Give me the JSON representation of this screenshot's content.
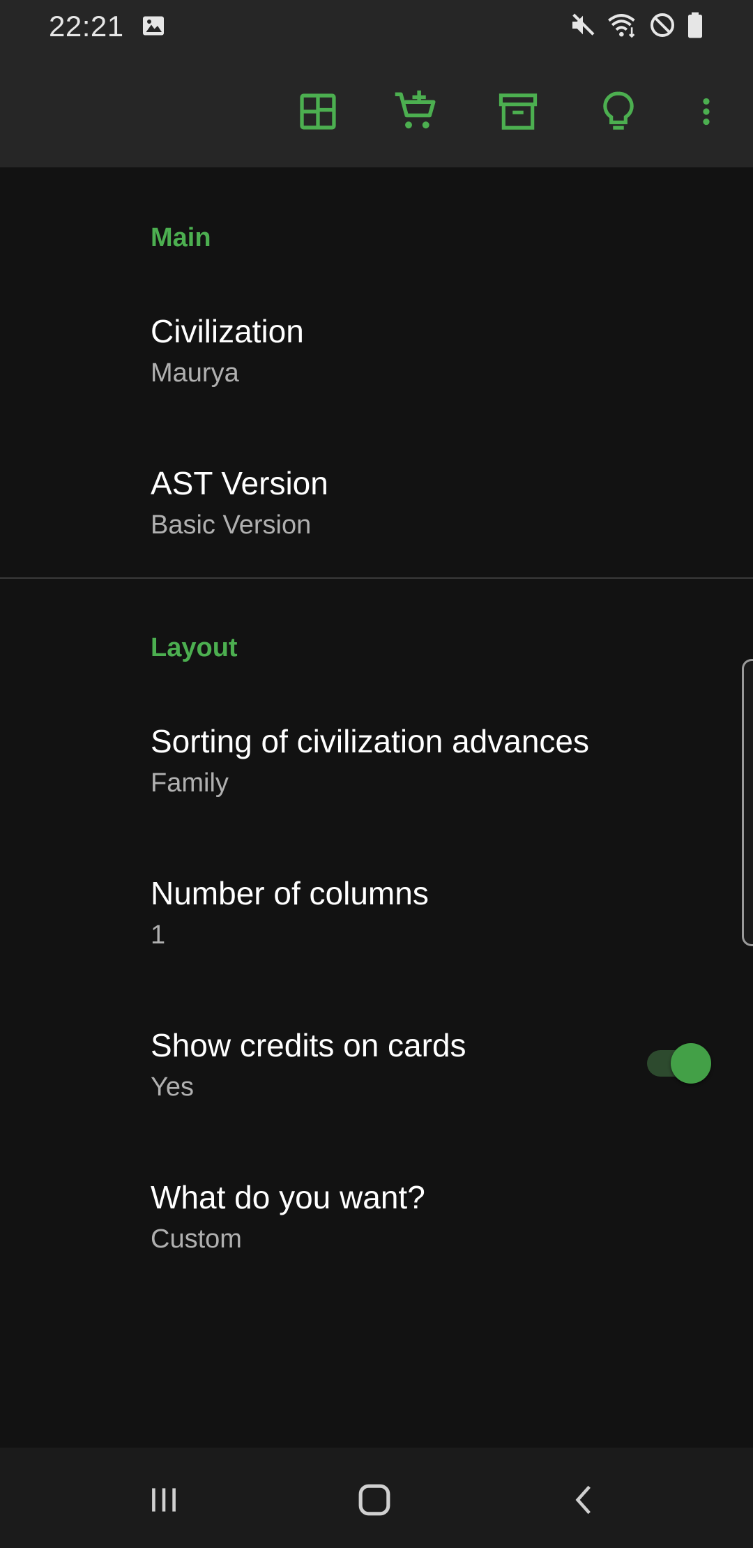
{
  "status_bar": {
    "time": "22:21",
    "icons": [
      "image-icon",
      "mute-icon",
      "wifi-icon",
      "blocked-icon",
      "battery-icon"
    ]
  },
  "toolbar": {
    "actions": [
      "layout-icon",
      "add-to-cart-icon",
      "archive-icon",
      "lightbulb-icon",
      "more-vert-icon"
    ],
    "accent_color": "#4caf50"
  },
  "sections": {
    "main": {
      "header": "Main",
      "civilization": {
        "title": "Civilization",
        "summary": "Maurya"
      },
      "ast_version": {
        "title": "AST Version",
        "summary": "Basic Version"
      }
    },
    "layout": {
      "header": "Layout",
      "sorting": {
        "title": "Sorting of civilization advances",
        "summary": "Family"
      },
      "columns": {
        "title": "Number of columns",
        "summary": "1"
      },
      "credits": {
        "title": "Show credits on cards",
        "summary": "Yes",
        "toggle_on": true
      },
      "want": {
        "title": "What do you want?",
        "summary": "Custom"
      }
    }
  },
  "nav_bar": {
    "buttons": [
      "recents-icon",
      "home-icon",
      "back-icon"
    ]
  }
}
